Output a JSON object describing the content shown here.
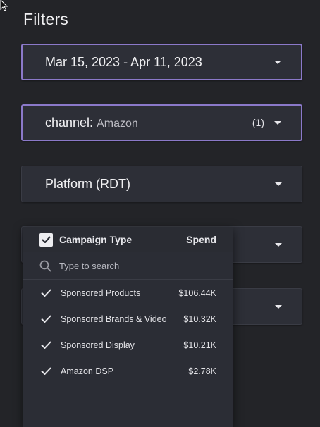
{
  "panel": {
    "title": "Filters"
  },
  "filters": {
    "date_range": {
      "label": "Mar 15, 2023 - Apr 11, 2023"
    },
    "channel": {
      "label": "channel:",
      "value": "Amazon",
      "count": "(1)"
    },
    "platform": {
      "label": "Platform (RDT)"
    }
  },
  "dropdown": {
    "column_label": "Campaign Type",
    "spend_label": "Spend",
    "search_placeholder": "Type to search",
    "options": [
      {
        "name": "Sponsored Products",
        "value": "$106.44K",
        "checked": true
      },
      {
        "name": "Sponsored Brands & Video",
        "value": "$10.32K",
        "checked": true
      },
      {
        "name": "Sponsored Display",
        "value": "$10.21K",
        "checked": true
      },
      {
        "name": "Amazon DSP",
        "value": "$2.78K",
        "checked": true
      }
    ]
  },
  "colors": {
    "background": "#232428",
    "card": "#2d2f37",
    "accent_border": "#8b79c9",
    "dropdown_bg": "#2b2d35"
  }
}
